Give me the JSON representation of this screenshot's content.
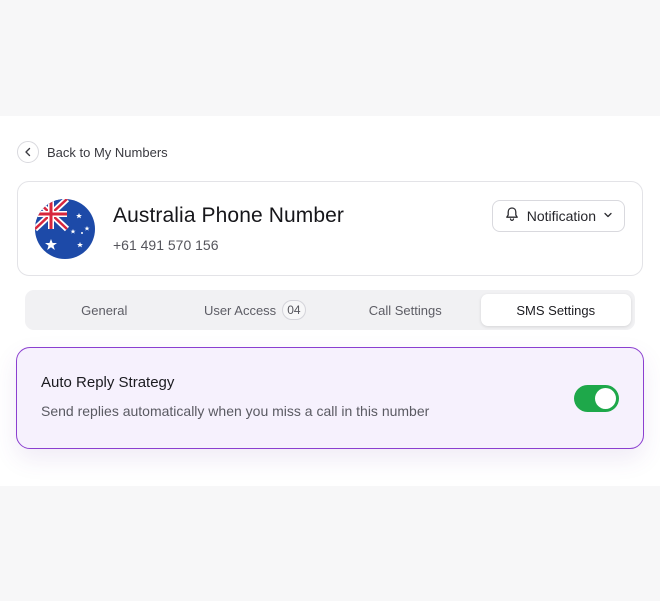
{
  "nav": {
    "back_label": "Back to My Numbers"
  },
  "number": {
    "title": "Australia Phone Number",
    "phone": "+61 491 570 156",
    "flag_icon": "australia-flag-icon"
  },
  "notification": {
    "label": "Notification"
  },
  "tabs": [
    {
      "label": "General",
      "active": false
    },
    {
      "label": "User Access",
      "badge": "04",
      "active": false
    },
    {
      "label": "Call Settings",
      "active": false
    },
    {
      "label": "SMS Settings",
      "active": true
    }
  ],
  "auto_reply": {
    "title": "Auto Reply Strategy",
    "description": "Send replies automatically when you miss a call in this number",
    "enabled": true
  },
  "colors": {
    "accent_purple": "#8b3fd0",
    "toggle_on": "#1ea84a",
    "card_tint": "#f6f1fd"
  }
}
